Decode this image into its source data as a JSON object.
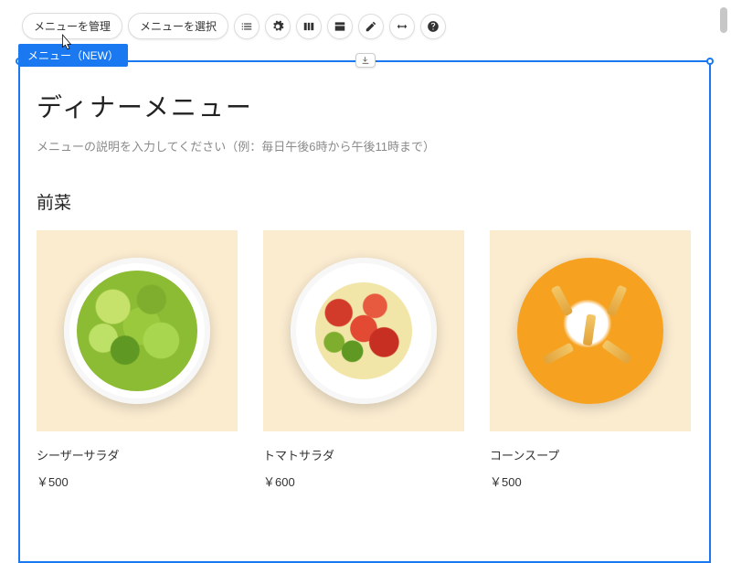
{
  "toolbar": {
    "manage_label": "メニューを管理",
    "select_label": "メニューを選択"
  },
  "tab": {
    "label": "メニュー（NEW）"
  },
  "page": {
    "title": "ディナーメニュー",
    "subtitle": "メニューの説明を入力してください（例：毎日午後6時から午後11時まで）",
    "section": "前菜"
  },
  "items": [
    {
      "name": "シーザーサラダ",
      "price": "￥500"
    },
    {
      "name": "トマトサラダ",
      "price": "￥600"
    },
    {
      "name": "コーンスープ",
      "price": "￥500"
    }
  ],
  "icons": {
    "list": "list-icon",
    "settings": "gear-icon",
    "columns": "columns-icon",
    "layout": "layout-icon",
    "edit": "pencil-icon",
    "dimensions": "arrows-h-icon",
    "help": "help-icon",
    "download": "download-icon"
  }
}
